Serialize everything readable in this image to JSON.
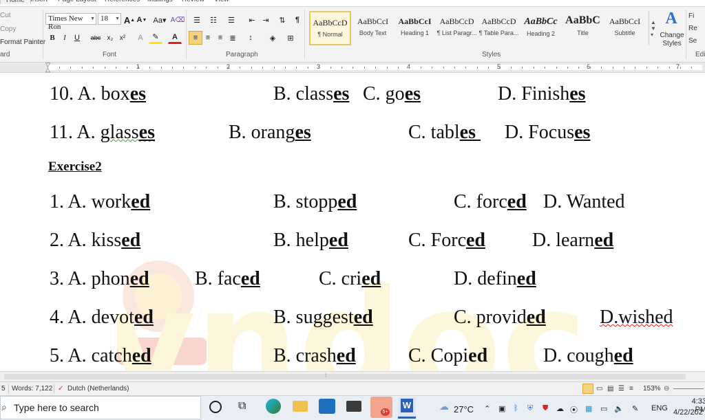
{
  "ribbon": {
    "tabs": [
      "Home",
      "Insert",
      "Page Layout",
      "References",
      "Mailings",
      "Review",
      "View"
    ],
    "clipboard": {
      "cut": "Cut",
      "copy": "Copy",
      "format_painter": "Format Painter",
      "group": "ard"
    },
    "font": {
      "name": "Times New Ron",
      "size": "18",
      "group": "Font"
    },
    "paragraph": {
      "group": "Paragraph"
    },
    "styles": {
      "group": "Styles",
      "items": [
        {
          "sample": "AaBbCcD",
          "name": "¶ Normal"
        },
        {
          "sample": "AaBbCcI",
          "name": "Body Text"
        },
        {
          "sample": "AaBbCcI",
          "name": "Heading 1"
        },
        {
          "sample": "AaBbCcD",
          "name": "¶ List Paragr..."
        },
        {
          "sample": "AaBbCcD",
          "name": "¶ Table Para..."
        },
        {
          "sample": "AaBbCc",
          "name": "Heading 2"
        },
        {
          "sample": "AaBbC",
          "name": "Title"
        },
        {
          "sample": "AaBbCcI",
          "name": "Subtitle"
        }
      ],
      "change_styles": "Change Styles",
      "editing_group": "Edi"
    }
  },
  "ruler": {
    "numbers": [
      "1",
      "2",
      "3",
      "4",
      "5",
      "6",
      "7"
    ]
  },
  "document": {
    "q10": {
      "a_num": "10. A. box",
      "a_end": "es",
      "b": "B. classes",
      "c_pre": "C. go",
      "c_end": "es",
      "d_pre": "D. Finish",
      "d_end": "es"
    },
    "q11": {
      "a": "11. A. glass",
      "a_end": "es",
      "b": "B. orang",
      "b_end": "es",
      "c": "C. tabl",
      "c_end": "es ",
      "d": "D. Focus",
      "d_end": "es"
    },
    "exercise_title": "Exercise2",
    "q1": {
      "a": "1. A. work",
      "b": "B. stopp",
      "c": "C. forc",
      "d": "D. Wanted"
    },
    "q2": {
      "a": "2. A. kiss",
      "b": "B. help",
      "c": "C. Forc",
      "d": "D. learn"
    },
    "q3": {
      "a": "3. A. phon",
      "b": "B. fac",
      "c": "C. cri",
      "d": "D. defin"
    },
    "q4": {
      "a": "4. A. devot",
      "b": "B. suggest",
      "c": "C. provid",
      "d": "D.wished"
    },
    "q5": {
      "a": "5. A. catch",
      "b": "B. crash",
      "c": "C. Copi",
      "d": "D. cough"
    },
    "suffix": "ed",
    "watermark": "vndoc"
  },
  "status": {
    "page": "5",
    "words": "Words: 7,122",
    "language": "Dutch (Netherlands)",
    "zoom": "153%"
  },
  "taskbar": {
    "search": "Type here to search",
    "temp": "27°C",
    "lang": "ENG",
    "time": "4:33 PM",
    "date": "4/22/202"
  }
}
